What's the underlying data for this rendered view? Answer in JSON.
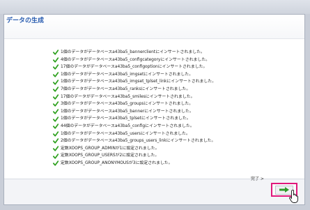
{
  "page": {
    "title": "データの生成",
    "messages": [
      "1個のデータがデータベースa43ba5_bannerclientにインサートされました。",
      "4個のデータがデータベースa43ba5_configcategoryにインサートされました。",
      "17個のデータがデータベースa43ba5_configoptionにインサートされました。",
      "1個のデータがデータベースa43ba5_imgsetにインサートされました。",
      "1個のデータがデータベースa43ba5_imgset_tplset_linkにインサートされました。",
      "7個のデータがデータベースa43ba5_ranksにインサートされました。",
      "17個のデータがデータベースa43ba5_smilesにインサートされました。",
      "3個のデータがデータベースa43ba5_groupsにインサートされました。",
      "1個のデータがデータベースa43ba5_bannerにインサートされました。",
      "1個のデータがデータベースa43ba5_tplsetにインサートされました。",
      "44個のデータがデータベースa43ba5_configにインサートされました。",
      "1個のデータがデータベースa43ba5_usersにインサートされました。",
      "2個のデータがデータベースa43ba5_groups_users_linkにインサートされました。",
      "定数XOOPS_GROUP_ADMINが1に設定されました。",
      "定数XOOPS_GROUP_USERSが2に設定されました。",
      "定数XOOPS_GROUP_ANONYMOUSが3に設定されました。"
    ],
    "next_label": "完了 >"
  },
  "icons": {
    "message": "check-icon",
    "next": "arrow-right-icon",
    "cursor": "cursor-pointer-icon"
  },
  "colors": {
    "title": "#2a5db0",
    "check": "#2fa11f",
    "next_border": "#e0177b",
    "arrow": "#2e9b2a"
  }
}
